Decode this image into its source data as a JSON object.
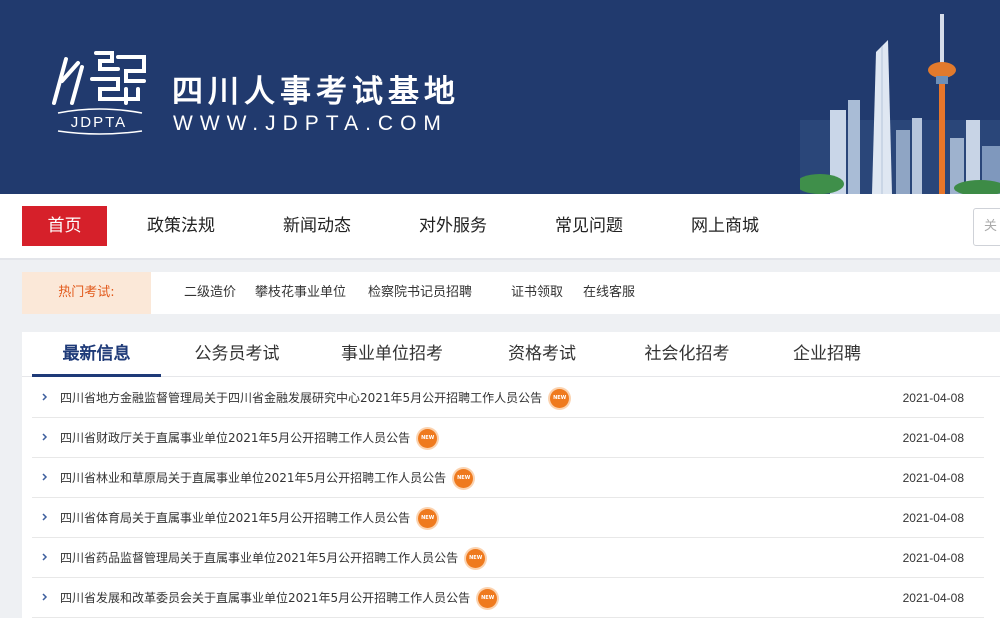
{
  "header": {
    "logo_text": "JDPTA",
    "site_title": "四川人事考试基地",
    "site_url": "WWW.JDPTA.COM",
    "colors": {
      "banner": "#213a6e",
      "accent": "#d6202a"
    }
  },
  "nav": {
    "items": [
      {
        "label": "首页",
        "active": true
      },
      {
        "label": "政策法规"
      },
      {
        "label": "新闻动态"
      },
      {
        "label": "对外服务"
      },
      {
        "label": "常见问题"
      },
      {
        "label": "网上商城"
      }
    ],
    "search_placeholder": "关"
  },
  "hot": {
    "label": "热门考试:",
    "links": [
      "二级造价",
      "攀枝花事业单位",
      "检察院书记员招聘",
      "证书领取",
      "在线客服"
    ]
  },
  "tabs": [
    {
      "label": "最新信息",
      "active": true
    },
    {
      "label": "公务员考试"
    },
    {
      "label": "事业单位招考"
    },
    {
      "label": "资格考试"
    },
    {
      "label": "社会化招考"
    },
    {
      "label": "企业招聘"
    }
  ],
  "news": [
    {
      "title": "四川省地方金融监督管理局关于四川省金融发展研究中心2021年5月公开招聘工作人员公告",
      "date": "2021-04-08",
      "badge": "NEW"
    },
    {
      "title": "四川省财政厅关于直属事业单位2021年5月公开招聘工作人员公告",
      "date": "2021-04-08",
      "badge": "NEW"
    },
    {
      "title": "四川省林业和草原局关于直属事业单位2021年5月公开招聘工作人员公告",
      "date": "2021-04-08",
      "badge": "NEW"
    },
    {
      "title": "四川省体育局关于直属事业单位2021年5月公开招聘工作人员公告",
      "date": "2021-04-08",
      "badge": "NEW"
    },
    {
      "title": "四川省药品监督管理局关于直属事业单位2021年5月公开招聘工作人员公告",
      "date": "2021-04-08",
      "badge": "NEW"
    },
    {
      "title": "四川省发展和改革委员会关于直属事业单位2021年5月公开招聘工作人员公告",
      "date": "2021-04-08",
      "badge": "NEW"
    }
  ]
}
